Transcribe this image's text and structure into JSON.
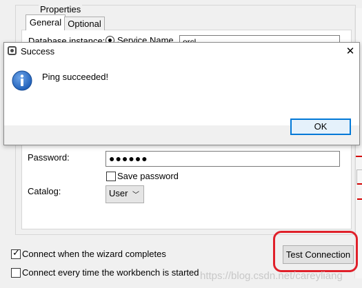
{
  "wizard": {
    "group_title": "Properties",
    "tabs": [
      {
        "label": "General"
      },
      {
        "label": "Optional"
      }
    ],
    "database_instance_label": "Database instance:",
    "service_name_label": "Service Name",
    "service_name_value": "orcl",
    "password_label": "Password:",
    "password_value": "●●●●●●",
    "save_password_label": "Save password",
    "save_password_checked": false,
    "catalog_label": "Catalog:",
    "catalog_value": "User",
    "connect_when_complete_label": "Connect when the wizard completes",
    "connect_when_complete_checked": true,
    "connect_every_time_label": "Connect every time the workbench is started",
    "connect_every_time_checked": false,
    "test_connection_label": "Test Connection",
    "highlight_color": "#e0202a"
  },
  "dialog": {
    "title": "Success",
    "message": "Ping succeeded!",
    "ok_label": "OK",
    "close_glyph": "✕",
    "icon": "info-icon"
  },
  "watermark": "https://blog.csdn.net/careyliang",
  "colors": {
    "info_blue": "#1f5fb8",
    "focus_blue": "#0078d7"
  }
}
